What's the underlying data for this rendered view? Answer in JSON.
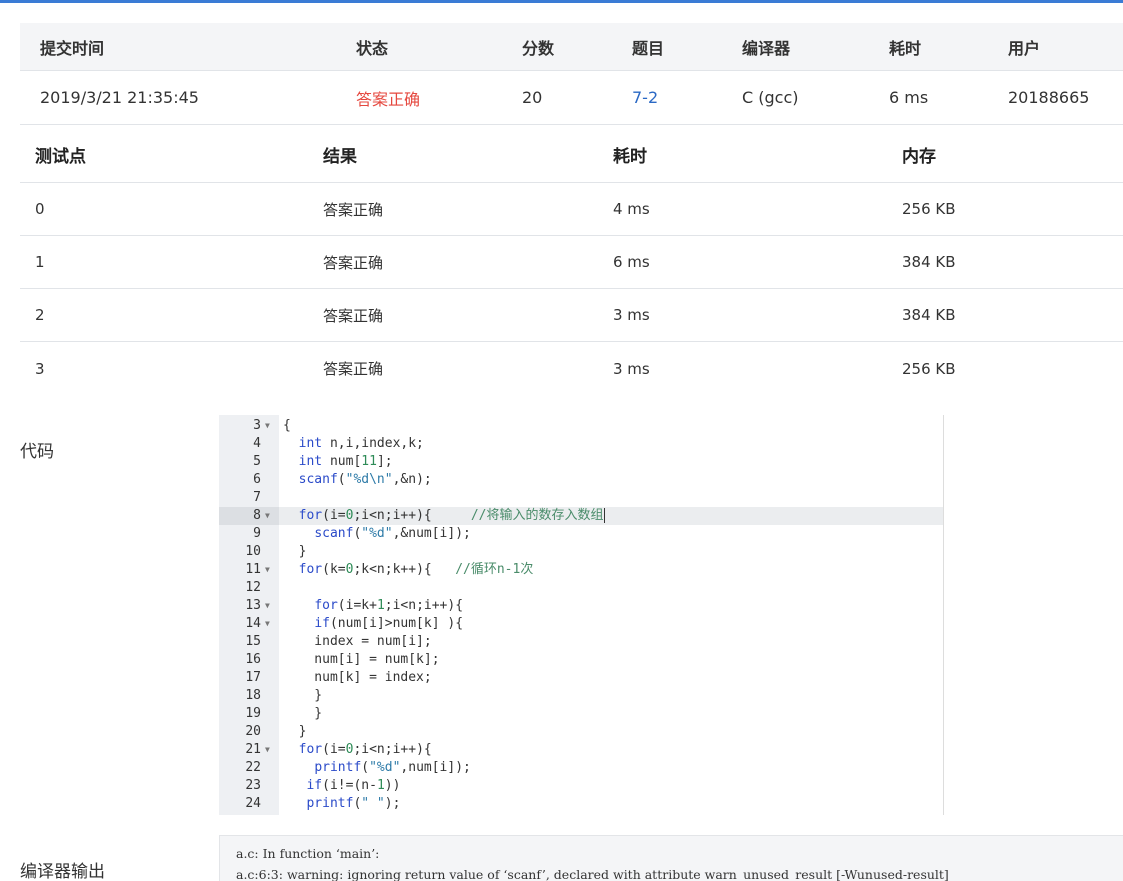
{
  "submission": {
    "headers": {
      "time": "提交时间",
      "status": "状态",
      "score": "分数",
      "problem": "题目",
      "compiler": "编译器",
      "cost": "耗时",
      "user": "用户"
    },
    "row": {
      "time": "2019/3/21 21:35:45",
      "status": "答案正确",
      "score": "20",
      "problem": "7-2",
      "compiler": "C (gcc)",
      "cost": "6 ms",
      "user": "20188665"
    }
  },
  "testcases": {
    "headers": {
      "case": "测试点",
      "result": "结果",
      "cost": "耗时",
      "memory": "内存"
    },
    "rows": [
      {
        "case": "0",
        "result": "答案正确",
        "cost": "4 ms",
        "memory": "256 KB"
      },
      {
        "case": "1",
        "result": "答案正确",
        "cost": "6 ms",
        "memory": "384 KB"
      },
      {
        "case": "2",
        "result": "答案正确",
        "cost": "3 ms",
        "memory": "384 KB"
      },
      {
        "case": "3",
        "result": "答案正确",
        "cost": "3 ms",
        "memory": "256 KB"
      }
    ]
  },
  "code": {
    "label": "代码",
    "lines": [
      {
        "n": "3",
        "fold": true,
        "text": "{"
      },
      {
        "n": "4",
        "fold": false,
        "text": "  int n,i,index,k;"
      },
      {
        "n": "5",
        "fold": false,
        "text": "  int num[11];"
      },
      {
        "n": "6",
        "fold": false,
        "text": "  scanf(\"%d\\n\",&n);"
      },
      {
        "n": "7",
        "fold": false,
        "text": ""
      },
      {
        "n": "8",
        "fold": true,
        "text": "  for(i=0;i<n;i++){     //将输入的数存入数组",
        "active": true
      },
      {
        "n": "9",
        "fold": false,
        "text": "    scanf(\"%d\",&num[i]);"
      },
      {
        "n": "10",
        "fold": false,
        "text": "  }"
      },
      {
        "n": "11",
        "fold": true,
        "text": "  for(k=0;k<n;k++){   //循环n-1次"
      },
      {
        "n": "12",
        "fold": false,
        "text": ""
      },
      {
        "n": "13",
        "fold": true,
        "text": "    for(i=k+1;i<n;i++){"
      },
      {
        "n": "14",
        "fold": true,
        "text": "    if(num[i]>num[k] ){"
      },
      {
        "n": "15",
        "fold": false,
        "text": "    index = num[i];"
      },
      {
        "n": "16",
        "fold": false,
        "text": "    num[i] = num[k];"
      },
      {
        "n": "17",
        "fold": false,
        "text": "    num[k] = index;"
      },
      {
        "n": "18",
        "fold": false,
        "text": "    }"
      },
      {
        "n": "19",
        "fold": false,
        "text": "    }"
      },
      {
        "n": "20",
        "fold": false,
        "text": "  }"
      },
      {
        "n": "21",
        "fold": true,
        "text": "  for(i=0;i<n;i++){"
      },
      {
        "n": "22",
        "fold": false,
        "text": "    printf(\"%d\",num[i]);"
      },
      {
        "n": "23",
        "fold": false,
        "text": "   if(i!=(n-1))"
      },
      {
        "n": "24",
        "fold": false,
        "text": "   printf(\" \");"
      }
    ]
  },
  "compiler_output": {
    "label": "编译器输出",
    "lines": [
      "a.c: In function ‘main’:",
      "a.c:6:3: warning: ignoring return value of ‘scanf’, declared with attribute warn_unused_result [-Wunused-result]"
    ]
  },
  "colors": {
    "accent": "#3a7bd5",
    "success": "#e5483f",
    "link": "#2a68c4"
  }
}
